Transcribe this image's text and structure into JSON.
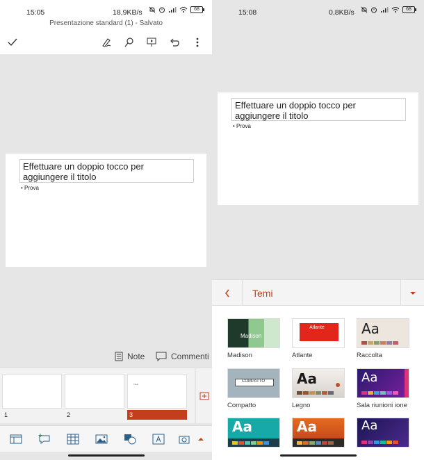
{
  "left": {
    "status": {
      "time": "15:05",
      "rate": "18,9KB/s",
      "battery": "68"
    },
    "title": "Presentazione standard (1) - Salvato",
    "slide": {
      "title": "Effettuare un doppio tocco per aggiungere il titolo",
      "bullet": "Prova"
    },
    "notes_label": "Note",
    "comments_label": "Commenti",
    "thumbnails": [
      {
        "num": "1"
      },
      {
        "num": "2"
      },
      {
        "num": "3",
        "mini": "Titolo"
      }
    ]
  },
  "right": {
    "status": {
      "time": "15:08",
      "rate": "0,8KB/s",
      "battery": "68"
    },
    "slide": {
      "title": "Effettuare un doppio tocco per aggiungere il titolo",
      "bullet": "Prova"
    },
    "themes_title": "Temi",
    "themes": [
      {
        "name": "Madison",
        "label": "Madison"
      },
      {
        "name": "Atlante",
        "label": "Atlante"
      },
      {
        "name": "Raccolta",
        "label": "Aa"
      },
      {
        "name": "Compatto",
        "label": "COMPATTO"
      },
      {
        "name": "Legno",
        "label": "Aa"
      },
      {
        "name": "Sala riunioni ione",
        "label": "Aa"
      },
      {
        "name": "",
        "label": "Aa"
      },
      {
        "name": "",
        "label": "Aa"
      },
      {
        "name": "",
        "label": "Aa"
      }
    ]
  },
  "colors": {
    "accent": "#c43e1c"
  }
}
